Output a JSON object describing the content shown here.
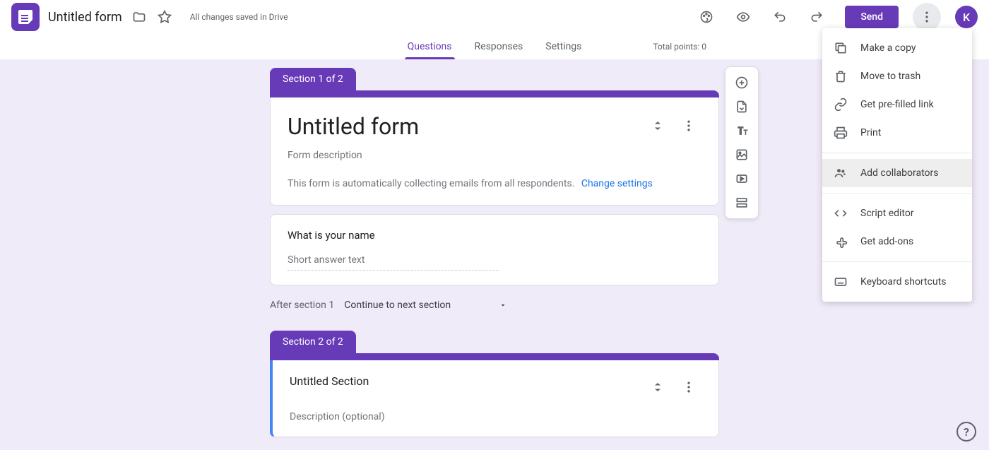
{
  "header": {
    "form_title": "Untitled form",
    "save_status": "All changes saved in Drive",
    "send_label": "Send",
    "avatar_letter": "K"
  },
  "tabs": {
    "questions": "Questions",
    "responses": "Responses",
    "settings": "Settings",
    "total_points": "Total points: 0"
  },
  "section1": {
    "tab_label": "Section 1 of 2",
    "title": "Untitled form",
    "description": "Form description",
    "email_notice": "This form is automatically collecting emails from all respondents.",
    "change_link": "Change settings"
  },
  "question1": {
    "text": "What is your name",
    "answer_placeholder": "Short answer text"
  },
  "after_section": {
    "label": "After section 1",
    "value": "Continue to next section"
  },
  "section2": {
    "tab_label": "Section 2 of 2",
    "title": "Untitled Section",
    "description": "Description (optional)"
  },
  "menu": {
    "make_copy": "Make a copy",
    "move_to_trash": "Move to trash",
    "prefilled": "Get pre-filled link",
    "print": "Print",
    "add_collab": "Add collaborators",
    "script_editor": "Script editor",
    "get_addons": "Get add-ons",
    "keyboard": "Keyboard shortcuts"
  }
}
